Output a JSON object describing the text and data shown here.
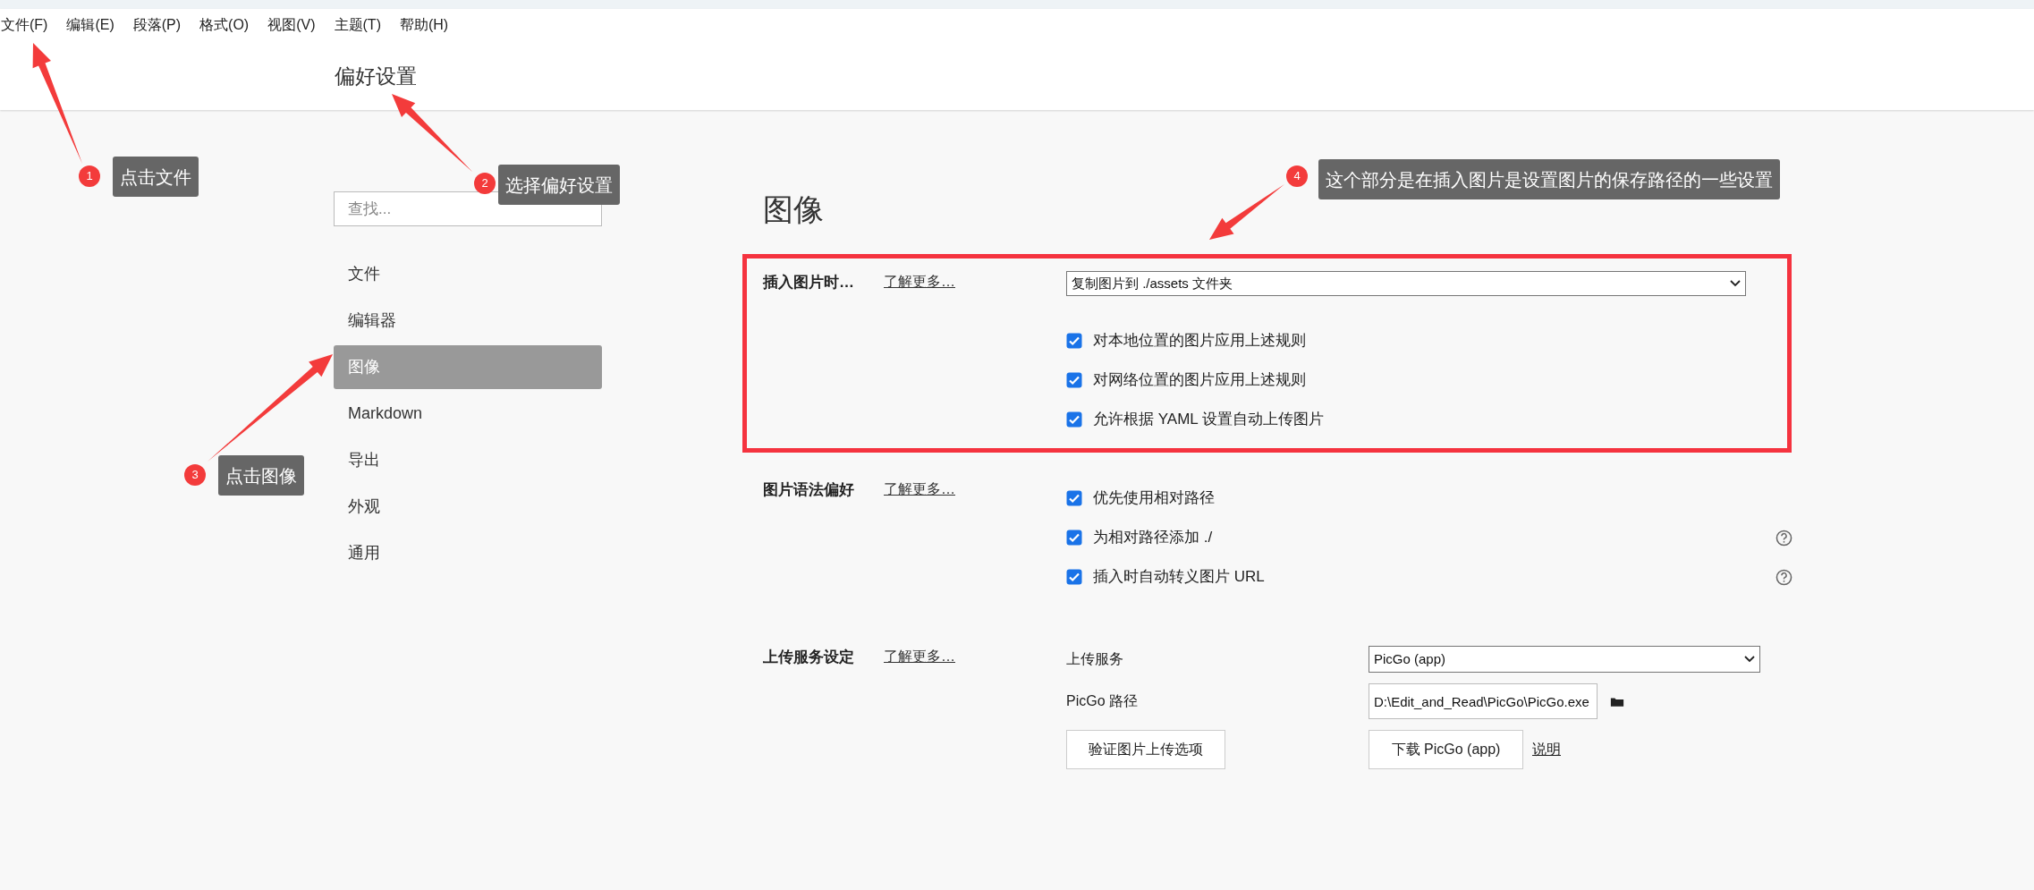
{
  "menu_bar": [
    "文件(F)",
    "编辑(E)",
    "段落(P)",
    "格式(O)",
    "视图(V)",
    "主题(T)",
    "帮助(H)"
  ],
  "header": {
    "title": "偏好设置"
  },
  "sidebar": {
    "search": {
      "placeholder": "查找..."
    },
    "items": [
      {
        "label": "文件",
        "selected": false
      },
      {
        "label": "编辑器",
        "selected": false
      },
      {
        "label": "图像",
        "selected": true
      },
      {
        "label": "Markdown",
        "selected": false
      },
      {
        "label": "导出",
        "selected": false
      },
      {
        "label": "外观",
        "selected": false
      },
      {
        "label": "通用",
        "selected": false
      }
    ]
  },
  "content": {
    "title": "图像",
    "sections": [
      {
        "label": "插入图片时…",
        "link": "了解更多…",
        "highlighted": true,
        "select": "复制图片到 ./assets 文件夹",
        "options": [
          {
            "label": "对本地位置的图片应用上述规则",
            "checked": true,
            "help": false
          },
          {
            "label": "对网络位置的图片应用上述规则",
            "checked": true,
            "help": false
          },
          {
            "label": "允许根据 YAML 设置自动上传图片",
            "checked": true,
            "help": false
          }
        ]
      },
      {
        "label": "图片语法偏好",
        "link": "了解更多…",
        "highlighted": false,
        "options": [
          {
            "label": "优先使用相对路径",
            "checked": true,
            "help": false
          },
          {
            "label": "为相对路径添加 ./",
            "checked": true,
            "help": true
          },
          {
            "label": "插入时自动转义图片 URL",
            "checked": true,
            "help": true
          }
        ]
      },
      {
        "label": "上传服务设定",
        "link": "了解更多…",
        "highlighted": false,
        "upload": {
          "service_label": "上传服务",
          "service": "PicGo (app)",
          "path_label": "PicGo 路径",
          "path": "D:\\Edit_and_Read\\PicGo\\PicGo.exe",
          "verify_button": "验证图片上传选项",
          "download_button": "下载 PicGo (app)",
          "help_link": "说明"
        }
      }
    ]
  },
  "annotations": [
    {
      "number": "1",
      "text": "点击文件"
    },
    {
      "number": "2",
      "text": "选择偏好设置"
    },
    {
      "number": "3",
      "text": "点击图像"
    },
    {
      "number": "4",
      "text": "这个部分是在插入图片是设置图片的保存路径的一些设置"
    }
  ]
}
